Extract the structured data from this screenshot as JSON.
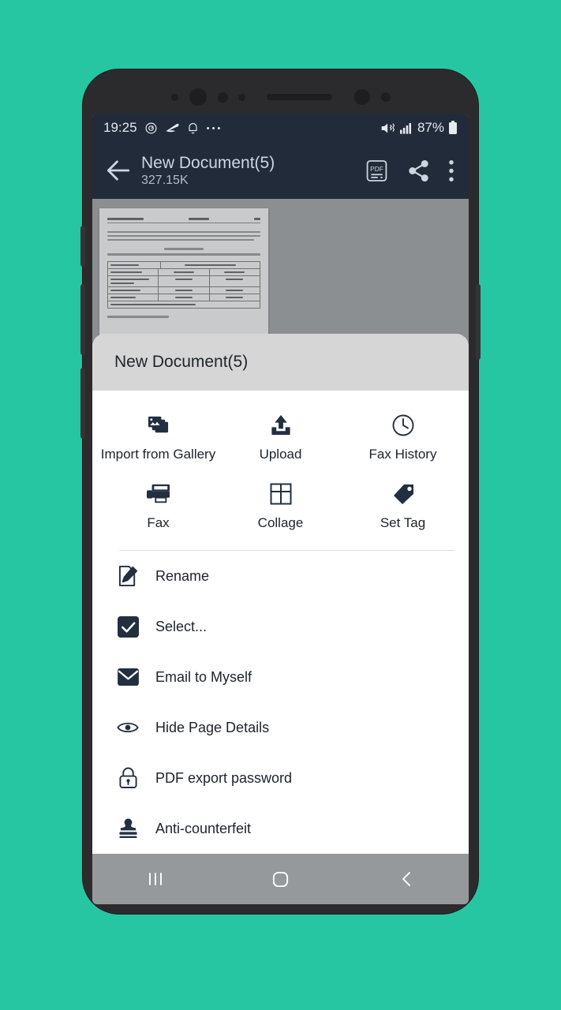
{
  "background_color": "#26c6a2",
  "phone": {
    "frame_color": "#2b2b2d",
    "side_buttons": [
      "bixby-button",
      "volume-down-button",
      "volume-up-button",
      "power-button"
    ]
  },
  "status_bar": {
    "time": "19:25",
    "battery_percent": "87%",
    "left_icons": [
      "alarm-icon",
      "scanner-icon",
      "bell-icon",
      "more-notifications-icon"
    ],
    "right_icons": [
      "vibrate-mute-icon",
      "signal-bars-icon",
      "battery-icon"
    ],
    "background_color": "#212b3a"
  },
  "app_bar": {
    "back_label": "back-arrow",
    "title": "New Document(5)",
    "subtitle": "327.15K",
    "actions": [
      "pdf-export-icon",
      "share-icon",
      "overflow-menu-icon"
    ],
    "background_color": "#212b3a"
  },
  "preview": {
    "document_name": "New Document(5)",
    "background_color": "#8c8f92"
  },
  "sheet": {
    "header_title": "New Document(5)",
    "header_background": "#d6d6d6",
    "grid": [
      {
        "label": "Import from Gallery",
        "icon": "gallery-stack-icon"
      },
      {
        "label": "Upload",
        "icon": "upload-icon"
      },
      {
        "label": "Fax History",
        "icon": "clock-icon"
      },
      {
        "label": "Fax",
        "icon": "printer-fax-icon"
      },
      {
        "label": "Collage",
        "icon": "grid-collage-icon"
      },
      {
        "label": "Set Tag",
        "icon": "tag-icon"
      }
    ],
    "list": [
      {
        "label": "Rename",
        "icon": "rename-pencil-icon"
      },
      {
        "label": "Select...",
        "icon": "checkbox-checked-icon"
      },
      {
        "label": "Email to Myself",
        "icon": "envelope-icon"
      },
      {
        "label": "Hide Page Details",
        "icon": "eye-icon"
      },
      {
        "label": "PDF export password",
        "icon": "lock-icon"
      },
      {
        "label": "Anti-counterfeit",
        "icon": "stamp-icon"
      }
    ],
    "icon_color": "#232f40"
  },
  "nav_bar": {
    "buttons": [
      "recents-button",
      "home-button",
      "back-button"
    ],
    "background_color": "#96999b"
  }
}
